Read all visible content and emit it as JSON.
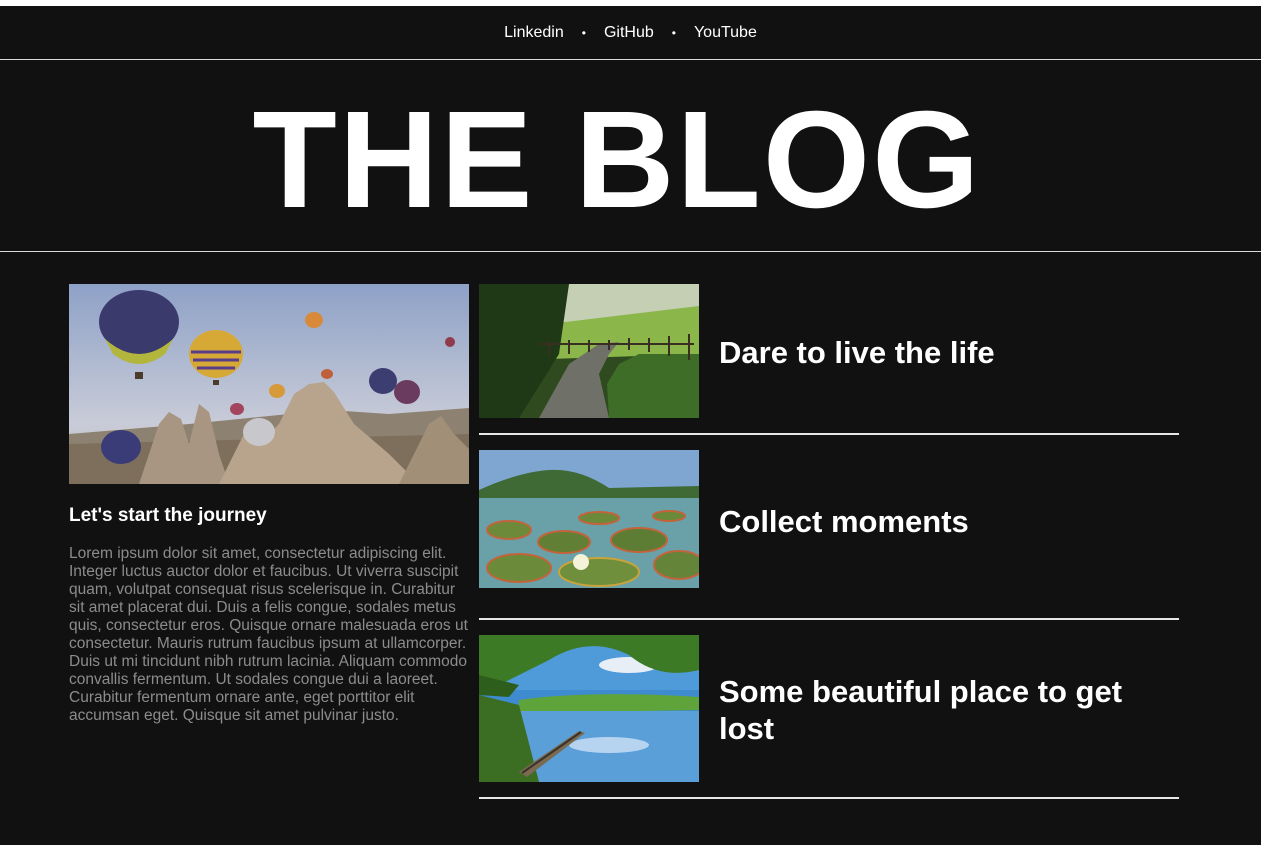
{
  "nav": {
    "links": [
      {
        "label": "Linkedin"
      },
      {
        "label": "GitHub"
      },
      {
        "label": "YouTube"
      }
    ],
    "separator": "•"
  },
  "header": {
    "title": "THE BLOG"
  },
  "featured": {
    "image": "hot-air-balloons-image",
    "title": "Let's start the journey",
    "body": "Lorem ipsum dolor sit amet, consectetur adipiscing elit. Integer luctus auctor dolor et faucibus. Ut viverra suscipit quam, volutpat consequat risus scelerisque in. Curabitur sit amet placerat dui. Duis a felis congue, sodales metus quis, consectetur eros. Quisque ornare malesuada eros ut consectetur. Mauris rutrum faucibus ipsum at ullamcorper. Duis ut mi tincidunt nibh rutrum lacinia. Aliquam commodo convallis fermentum. Ut sodales congue dui a laoreet. Curabitur fermentum ornare ante, eget porttitor elit accumsan eget. Quisque sit amet pulvinar justo."
  },
  "posts": [
    {
      "image": "country-path-image",
      "title": "Dare to live the life"
    },
    {
      "image": "lily-pond-image",
      "title": "Collect moments"
    },
    {
      "image": "lake-boat-image",
      "title": "Some beautiful place to get lost"
    }
  ],
  "colors": {
    "background": "#111111",
    "text": "#ffffff",
    "muted": "#8c8c8c",
    "divider": "#e6e6e6"
  }
}
